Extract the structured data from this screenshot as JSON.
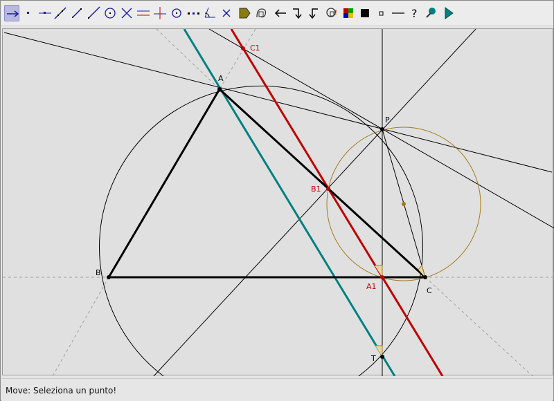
{
  "toolbar": {
    "tools": [
      {
        "id": "move",
        "icon": "move-arrow-icon",
        "active": true
      },
      {
        "id": "point",
        "icon": "point-icon"
      },
      {
        "id": "point-on-line",
        "icon": "point-on-line-icon"
      },
      {
        "id": "line",
        "icon": "line-icon"
      },
      {
        "id": "segment",
        "icon": "segment-icon"
      },
      {
        "id": "ray",
        "icon": "ray-icon"
      },
      {
        "id": "circle",
        "icon": "circle-icon"
      },
      {
        "id": "intersection",
        "icon": "intersection-icon"
      },
      {
        "id": "parallel",
        "icon": "parallel-line-icon"
      },
      {
        "id": "perpendicular",
        "icon": "perpendicular-line-icon"
      },
      {
        "id": "center",
        "icon": "circle-center-icon"
      },
      {
        "id": "midpoint",
        "icon": "midpoint-icon"
      },
      {
        "id": "angle",
        "icon": "angle-icon"
      },
      {
        "id": "delete",
        "icon": "delete-x-icon"
      },
      {
        "id": "label",
        "icon": "label-tag-icon"
      },
      {
        "id": "locus",
        "icon": "locus-icon"
      },
      {
        "id": "undo",
        "icon": "undo-arrow-icon"
      },
      {
        "id": "redo-step",
        "icon": "step-forward-icon"
      },
      {
        "id": "step-back",
        "icon": "step-back-icon"
      },
      {
        "id": "check",
        "icon": "check-property-icon"
      },
      {
        "id": "color",
        "icon": "color-palette-icon"
      },
      {
        "id": "filled",
        "icon": "filled-square-icon"
      },
      {
        "id": "point-style",
        "icon": "small-square-icon"
      },
      {
        "id": "line-style",
        "icon": "line-style-icon"
      },
      {
        "id": "help",
        "icon": "question-mark-icon"
      },
      {
        "id": "macro",
        "icon": "macro-icon"
      },
      {
        "id": "run",
        "icon": "play-triangle-icon"
      }
    ]
  },
  "canvas": {
    "points": [
      {
        "id": "A",
        "label": "A",
        "color": "#000000"
      },
      {
        "id": "B",
        "label": "B",
        "color": "#000000"
      },
      {
        "id": "C",
        "label": "C",
        "color": "#000000"
      },
      {
        "id": "P",
        "label": "P",
        "color": "#000000"
      },
      {
        "id": "T",
        "label": "T",
        "color": "#000000"
      },
      {
        "id": "A1",
        "label": "A1",
        "color": "#c00000"
      },
      {
        "id": "B1",
        "label": "B1",
        "color": "#c00000"
      },
      {
        "id": "C1",
        "label": "C1",
        "color": "#c00000"
      }
    ],
    "colors": {
      "simson_line": "#c00000",
      "steiner_line": "#008080",
      "small_circle": "#a57a1e",
      "construction": "#000000",
      "dashed": "#a0a0a0",
      "background": "#e0e0e0"
    }
  },
  "status": {
    "message": "Move: Seleziona un punto!"
  }
}
